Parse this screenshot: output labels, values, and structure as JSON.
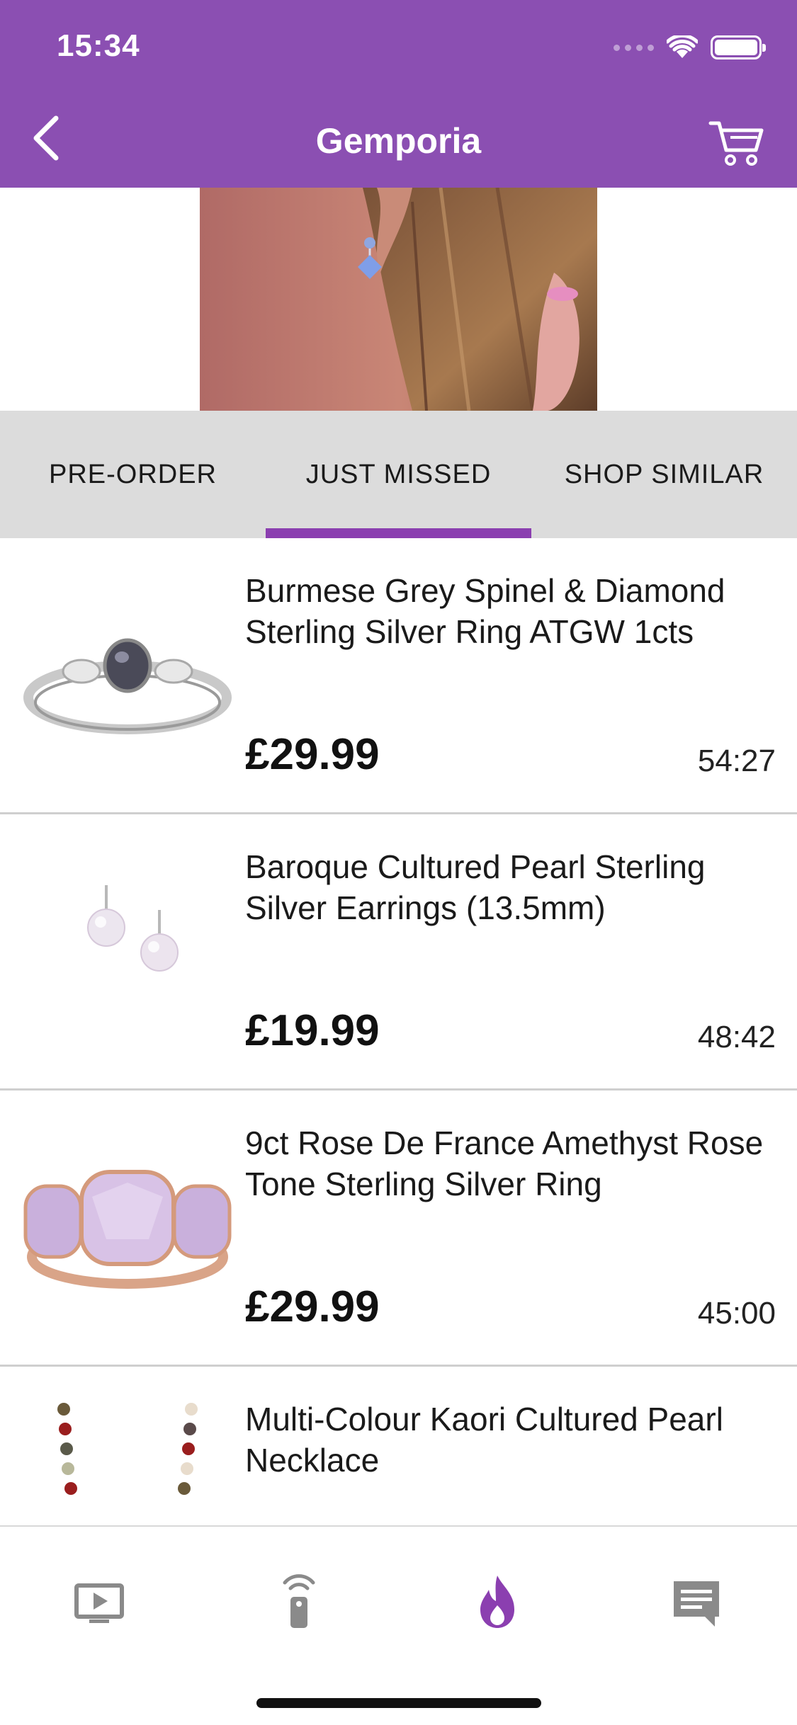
{
  "status_bar": {
    "time": "15:34"
  },
  "nav": {
    "title": "Gemporia"
  },
  "tabs": [
    {
      "label": "PRE-ORDER"
    },
    {
      "label": "JUST MISSED"
    },
    {
      "label": "SHOP SIMILAR"
    }
  ],
  "selected_tab": "JUST MISSED",
  "colors": {
    "brand": "#8b4fb2",
    "accent": "#8b3fb0",
    "tab_bg": "#dcdcdc"
  },
  "products": [
    {
      "title": "Burmese Grey Spinel & Diamond Sterling Silver Ring ATGW 1cts",
      "price": "£29.99",
      "time": "54:27",
      "icon": "grey-spinel-ring"
    },
    {
      "title": "Baroque Cultured Pearl Sterling Silver Earrings (13.5mm)",
      "price": "£19.99",
      "time": "48:42",
      "icon": "pearl-earrings"
    },
    {
      "title": "9ct Rose De France Amethyst Rose Tone Sterling Silver Ring",
      "price": "£29.99",
      "time": "45:00",
      "icon": "amethyst-ring"
    },
    {
      "title": "Multi-Colour Kaori Cultured Pearl Necklace",
      "price": "",
      "time": "",
      "icon": "pearl-necklace"
    }
  ],
  "tab_bar": [
    {
      "icon": "tv-play-icon"
    },
    {
      "icon": "remote-icon"
    },
    {
      "icon": "flame-icon",
      "active": true
    },
    {
      "icon": "chat-icon"
    }
  ]
}
